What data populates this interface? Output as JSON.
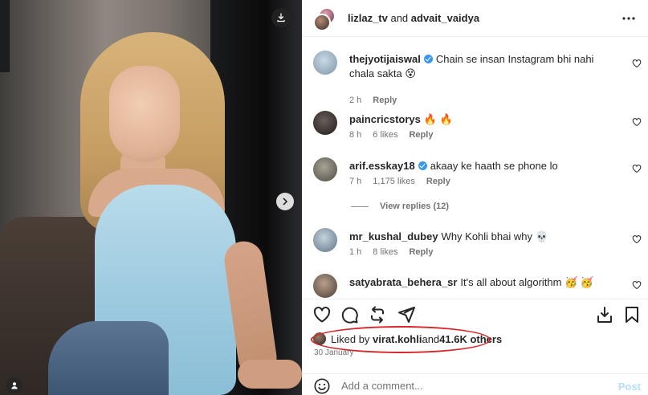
{
  "post": {
    "image_alt": "photo",
    "carousel": true
  },
  "header": {
    "user1": "lizlaz_tv",
    "and": " and ",
    "user2": "advait_vaidya"
  },
  "comments": [
    {
      "user": "thejyotijaiswal",
      "verified": true,
      "text": "Chain se insan Instagram bhi nahi chala sakta 😵",
      "time": "2 h",
      "likes": "",
      "reply": "Reply",
      "avatar_color": "#9fb7c9"
    },
    {
      "user": "paincricstorys",
      "verified": false,
      "text": "🔥 🔥",
      "time": "8 h",
      "likes": "6 likes",
      "reply": "Reply",
      "avatar_color": "#3a3432"
    },
    {
      "user": "arif.esskay18",
      "verified": true,
      "text": "akaay ke haath se phone lo",
      "time": "7 h",
      "likes": "1,175 likes",
      "reply": "Reply",
      "avatar_color": "#6e6b62"
    },
    {
      "user": "mr_kushal_dubey",
      "verified": false,
      "text": "Why Kohli bhai why 💀",
      "time": "1 h",
      "likes": "8 likes",
      "reply": "Reply",
      "avatar_color": "#8fa4b8"
    },
    {
      "user": "satyabrata_behera_sr",
      "verified": false,
      "text": "It's all about algorithm 🥳 🥳",
      "time": "",
      "likes": "",
      "reply": "",
      "avatar_color": "#7d6a5c"
    }
  ],
  "view_replies": "View replies (12)",
  "likes": {
    "prefix": "Liked by ",
    "user": "virat.kohli",
    "middle": " and ",
    "count": "41.6K others"
  },
  "date": "30 January",
  "add_comment": {
    "placeholder": "Add a comment...",
    "post_label": "Post"
  },
  "colors": {
    "accent": "#3897f0",
    "highlight_ellipse": "#d9262a",
    "post_disabled": "#b2dffc"
  },
  "icons": {
    "like": "heart-icon",
    "comment": "comment-icon",
    "share": "repost-icon",
    "send": "send-icon",
    "save": "bookmark-icon",
    "stats": "insights-icon",
    "emoji": "emoji-icon",
    "more": "more-icon"
  }
}
